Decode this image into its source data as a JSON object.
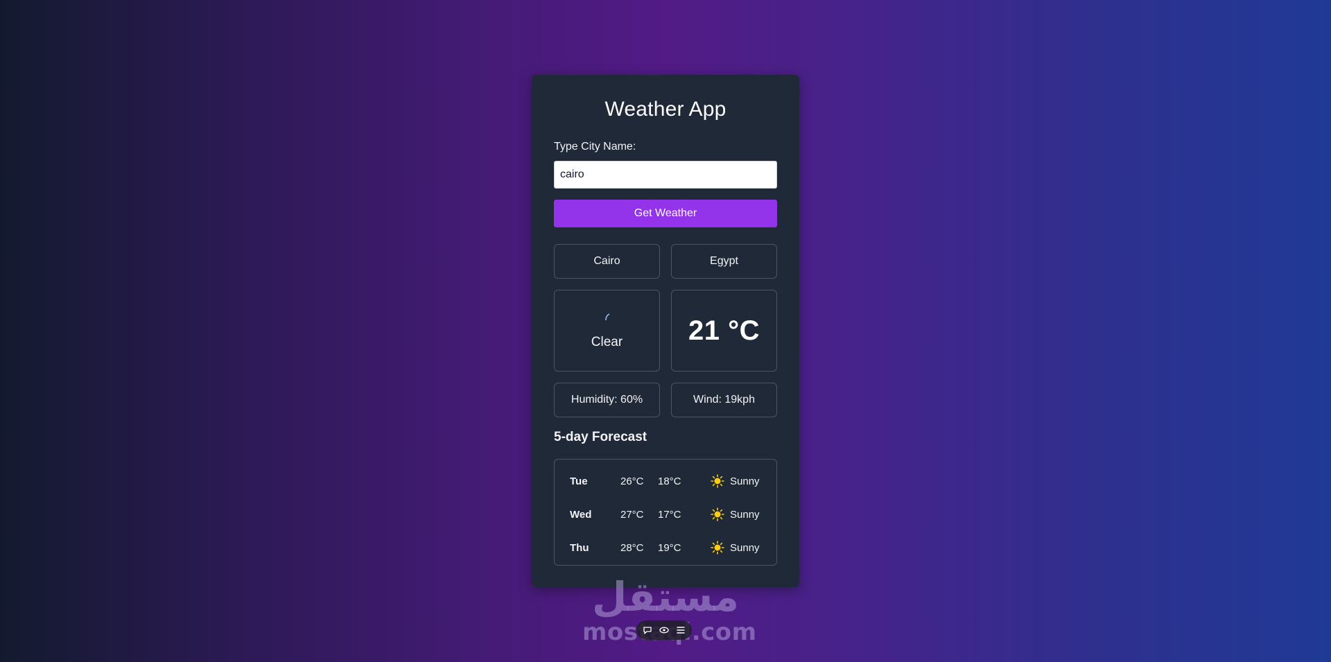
{
  "app": {
    "title": "Weather App"
  },
  "search": {
    "label": "Type City Name:",
    "value": "cairo",
    "button_label": "Get Weather"
  },
  "current": {
    "city": "Cairo",
    "country": "Egypt",
    "condition": "Clear",
    "condition_icon": "moon-icon",
    "temperature": "21 °C",
    "humidity": "Humidity: 60%",
    "wind": "Wind: 19kph"
  },
  "forecast": {
    "title": "5-day Forecast",
    "days": [
      {
        "day": "Tue",
        "high": "26°C",
        "low": "18°C",
        "icon": "sun-icon",
        "condition": "Sunny"
      },
      {
        "day": "Wed",
        "high": "27°C",
        "low": "17°C",
        "icon": "sun-icon",
        "condition": "Sunny"
      },
      {
        "day": "Thu",
        "high": "28°C",
        "low": "19°C",
        "icon": "sun-icon",
        "condition": "Sunny"
      }
    ]
  },
  "watermark": {
    "arabic": "مستقل",
    "latin": "mostaql.com"
  },
  "toolbar": {
    "icons": [
      "comment-icon",
      "eye-icon",
      "list-icon"
    ]
  },
  "colors": {
    "card_bg": "#1f2937",
    "accent": "#9333ea",
    "border": "#4b5563",
    "sun": "#facc15",
    "moon": "#3b82f6"
  }
}
